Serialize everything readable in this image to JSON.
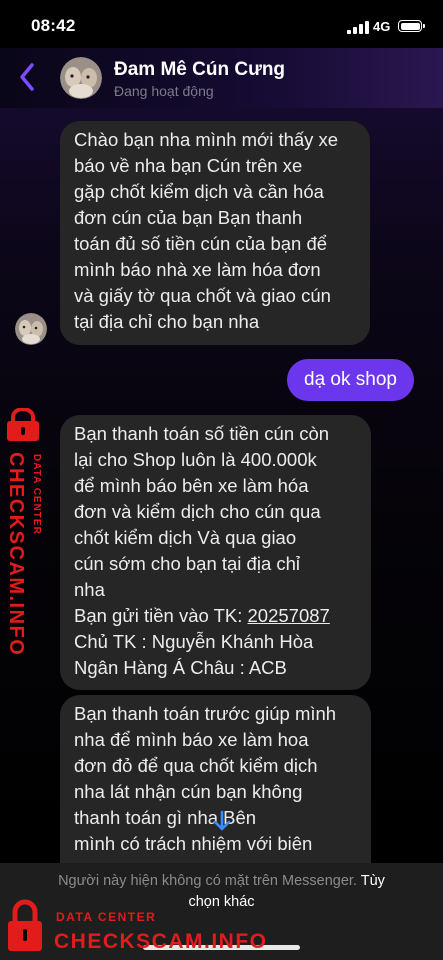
{
  "status_bar": {
    "time": "08:42",
    "network": "4G"
  },
  "header": {
    "contact_name": "Đam Mê Cún Cưng",
    "contact_status": "Đang hoạt động"
  },
  "messages": [
    {
      "sender": "contact",
      "lines": [
        "Chào bạn nha mình mới thấy xe",
        "báo về nha bạn Cún trên  xe",
        "gặp chốt kiểm dịch và cần hóa",
        "đơn cún của bạn Bạn thanh",
        "toán đủ số tiền cún của bạn để",
        "mình báo nhà xe làm hóa đơn",
        "và giấy tờ qua chốt và giao cún",
        "tại địa chỉ  cho bạn nha"
      ]
    },
    {
      "sender": "me",
      "text": "dạ ok shop"
    },
    {
      "sender": "contact",
      "lines": [
        "Bạn thanh toán số tiền cún còn",
        "lại cho Shop luôn là 400.000k",
        "để mình báo bên xe làm hóa",
        "đơn và kiểm dịch cho cún qua",
        "chốt kiểm dịch Và qua  giao",
        "cún sớm cho bạn tại địa chỉ",
        "nha"
      ],
      "account_prefix": "Bạn gửi tiền vào TK: ",
      "account_number": "20257087",
      "account_lines": [
        "Chủ TK : Nguyễn Khánh Hòa",
        "Ngân Hàng Á Châu : ACB"
      ]
    },
    {
      "sender": "contact",
      "lines": [
        "Bạn thanh toán trước giúp mình",
        "nha để mình báo xe làm hoa",
        "đơn đỏ để qua chốt kiểm dịch",
        "nha  lát nhận cún bạn không",
        "thanh toán gì     nha  Bên",
        "mình có trách nhiệm với biên"
      ]
    }
  ],
  "notice": {
    "muted_text": "Người này hiện không có mặt trên Messenger.",
    "link_part1": "Tùy",
    "link_part2": "chọn khác"
  },
  "watermark": {
    "brand": "CHECKSCAM.INFO",
    "label": "DATA CENTER",
    "color": "#e21b1b"
  },
  "icons": [
    "back-arrow-icon",
    "scroll-down-arrow-icon",
    "signal-icon",
    "battery-icon",
    "lock-icon"
  ],
  "colors": {
    "outgoing_bubble": "#6b36ec",
    "incoming_bubble": "#262626",
    "accent": "#7b4dff"
  }
}
